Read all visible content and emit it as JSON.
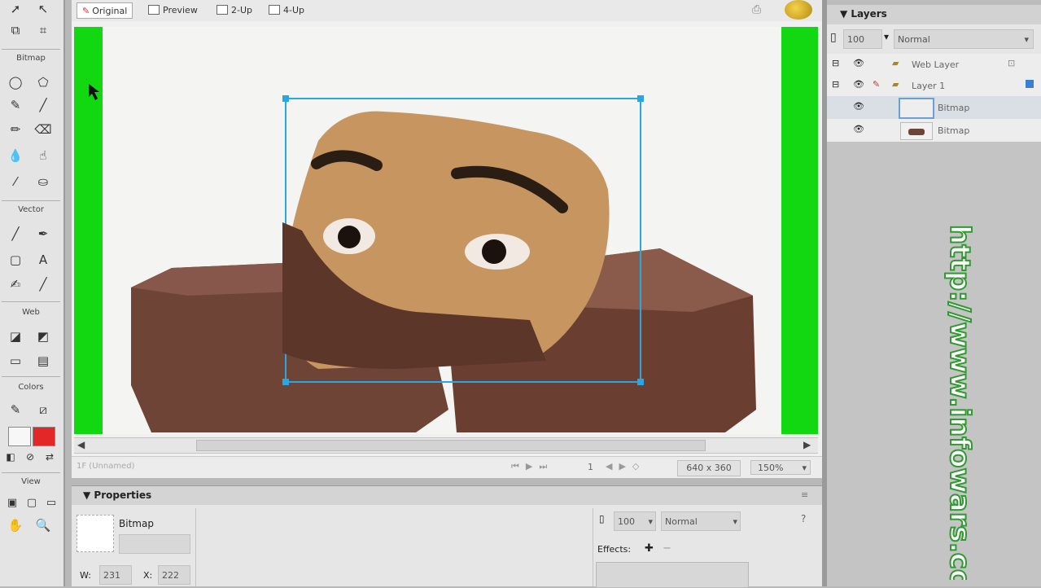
{
  "tools_panel": {
    "sections": {
      "bitmap": "Bitmap",
      "vector": "Vector",
      "web": "Web",
      "colors": "Colors",
      "view": "View"
    }
  },
  "document": {
    "tabs": {
      "original": "Original",
      "preview": "Preview",
      "two_up": "2-Up",
      "four_up": "4-Up"
    },
    "status": {
      "selection": "1F (Unnamed)",
      "frame": "1",
      "size": "640 x 360",
      "zoom": "150%"
    }
  },
  "properties": {
    "title": "Properties",
    "object_type": "Bitmap",
    "w_label": "W:",
    "w_value": "231",
    "x_label": "X:",
    "x_value": "222",
    "opacity": "100",
    "blend_mode": "Normal",
    "effects_label": "Effects:"
  },
  "layers": {
    "title": "Layers",
    "opacity": "100",
    "blend_mode": "Normal",
    "rows": [
      {
        "name": "Web Layer"
      },
      {
        "name": "Layer 1"
      },
      {
        "name": "Bitmap"
      },
      {
        "name": "Bitmap"
      }
    ]
  },
  "watermark": {
    "text": "http://www.infowars.com"
  }
}
